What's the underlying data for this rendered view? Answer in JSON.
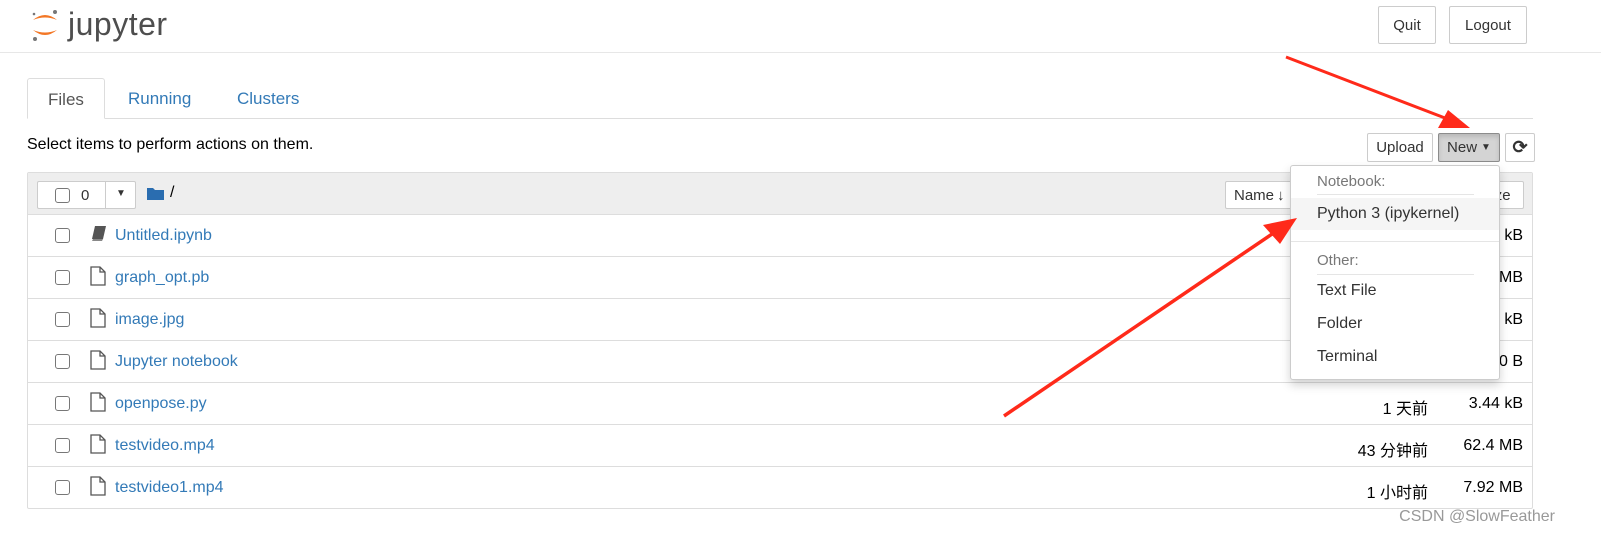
{
  "header": {
    "logo_text": "jupyter",
    "quit": "Quit",
    "logout": "Logout"
  },
  "tabs": [
    {
      "label": "Files",
      "active": true
    },
    {
      "label": "Running"
    },
    {
      "label": "Clusters"
    }
  ],
  "toolbar": {
    "hint": "Select items to perform actions on them.",
    "upload": "Upload",
    "new": "New",
    "refresh_icon": "refresh-icon"
  },
  "list_header": {
    "selected_count": "0",
    "path": "/",
    "sort_name": "Name",
    "size_label": "Size"
  },
  "files": [
    {
      "name": "Untitled.ipynb",
      "type": "notebook",
      "modified": "",
      "size": "kB"
    },
    {
      "name": "graph_opt.pb",
      "type": "file",
      "modified": "",
      "size": "MB"
    },
    {
      "name": "image.jpg",
      "type": "file",
      "modified": "",
      "size": "kB"
    },
    {
      "name": "Jupyter notebook",
      "type": "file",
      "modified": "",
      "size": "0 B"
    },
    {
      "name": "openpose.py",
      "type": "file",
      "modified": "1 天前",
      "size": "3.44 kB"
    },
    {
      "name": "testvideo.mp4",
      "type": "file",
      "modified": "43 分钟前",
      "size": "62.4 MB"
    },
    {
      "name": "testvideo1.mp4",
      "type": "file",
      "modified": "1 小时前",
      "size": "7.92 MB"
    }
  ],
  "new_menu": {
    "notebook_header": "Notebook:",
    "python": "Python 3 (ipykernel)",
    "other_header": "Other:",
    "text_file": "Text File",
    "folder": "Folder",
    "terminal": "Terminal"
  },
  "colors": {
    "link": "#337ab7",
    "logo_orange": "#f37726",
    "annotation_arrow": "#ff2a1a"
  },
  "watermark": "CSDN @SlowFeather"
}
